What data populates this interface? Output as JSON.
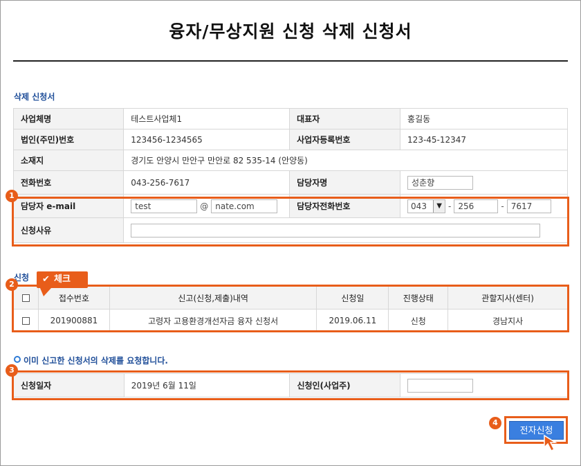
{
  "page_title": "융자/무상지원 신청 삭제 신청서",
  "section_delete": "삭제 신청서",
  "company": {
    "name_label": "사업체명",
    "name_value": "테스트사업체1",
    "rep_label": "대표자",
    "rep_value": "홍길동",
    "corp_no_label": "법인(주민)번호",
    "corp_no_value": "123456-1234565",
    "biz_no_label": "사업자등록번호",
    "biz_no_value": "123-45-12347",
    "address_label": "소재지",
    "address_value": "경기도 안양시 만안구 만안로 82 535-14 (안양동)",
    "phone_label": "전화번호",
    "phone_value": "043-256-7617",
    "manager_label": "담당자명",
    "manager_value": "성춘향",
    "email_label": "담당자 e-mail",
    "email_id": "test",
    "email_at": "@",
    "email_domain": "nate.com",
    "manager_phone_label": "담당자전화번호",
    "phone_area": "043",
    "phone_mid": "256",
    "phone_last": "7617",
    "phone_dash": "-",
    "reason_label": "신청사유",
    "reason_value": ""
  },
  "badges": {
    "b1": "1",
    "b2": "2",
    "b3": "3",
    "b4": "4"
  },
  "section_apply_partial": "신청",
  "tag_label": "체크",
  "history_table": {
    "headers": [
      "접수번호",
      "신고(신청,제출)내역",
      "신청일",
      "진행상태",
      "관할지사(센터)"
    ],
    "rows": [
      [
        "201900881",
        "고령자 고용환경개선자금 융자 신청서",
        "2019.06.11",
        "신청",
        "경남지사"
      ]
    ]
  },
  "note": "이미 신고한 신청서의 삭제를 요청합니다.",
  "apply": {
    "date_label": "신청일자",
    "date_value": "2019년 6월 11일",
    "applicant_label": "신청인(사업주)",
    "applicant_value": ""
  },
  "submit_label": "전자신청",
  "colors": {
    "accent": "#e85d1a",
    "button": "#3a7fe0",
    "section": "#1f4e99"
  }
}
